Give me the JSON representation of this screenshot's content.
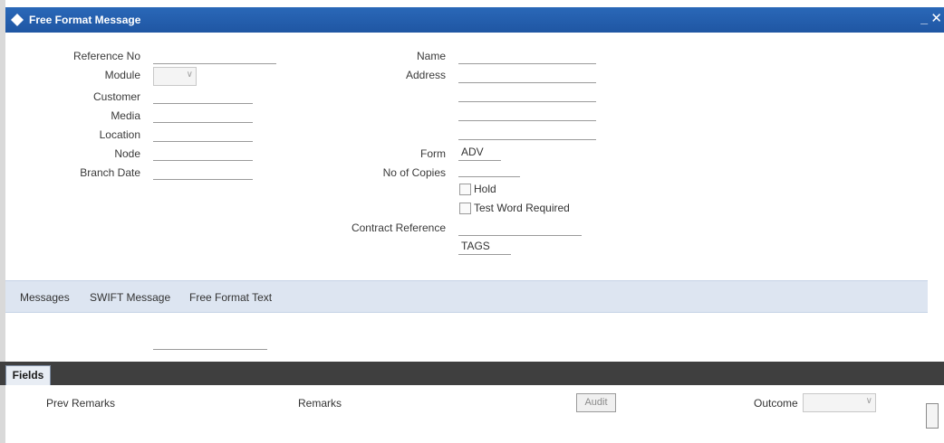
{
  "window": {
    "title": "Free Format Message",
    "minimize": "_",
    "close": "✕",
    "icon": "diamond-icon"
  },
  "form_left": {
    "reference_no": "Reference No",
    "module": "Module",
    "customer": "Customer",
    "media": "Media",
    "location": "Location",
    "node": "Node",
    "branch_date": "Branch Date"
  },
  "form_right": {
    "name": "Name",
    "address": "Address",
    "form": "Form",
    "form_value": "ADV",
    "no_of_copies": "No of Copies",
    "hold": "Hold",
    "test_word_required": "Test Word Required",
    "contract_reference": "Contract Reference",
    "tags": "TAGS"
  },
  "tabs": [
    "Messages",
    "SWIFT Message",
    "Free Format Text"
  ],
  "footer": {
    "fields_tab": "Fields",
    "prev_remarks": "Prev Remarks",
    "remarks": "Remarks",
    "audit": "Audit",
    "outcome": "Outcome"
  },
  "colors": {
    "titlebar": "#1f56a3",
    "tabbar": "#dde5f1",
    "darkbar": "#3f3f3f"
  }
}
